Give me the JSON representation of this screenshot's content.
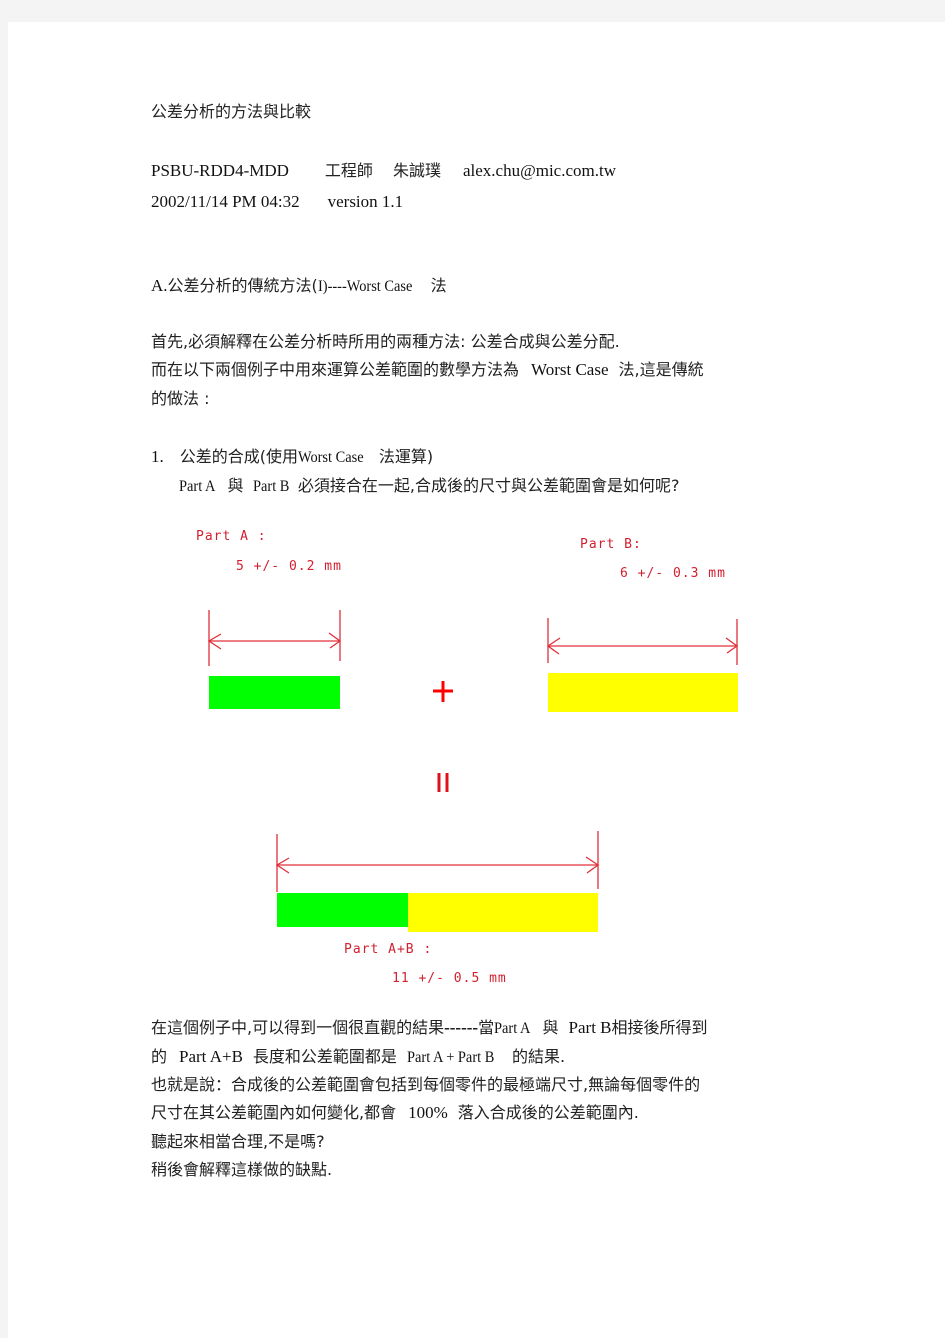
{
  "document": {
    "title": "公差分析的方法與比較",
    "author_line": {
      "department": "PSBU-RDD4-MDD",
      "role": "工程師",
      "name": "朱誠璞",
      "email": "alex.chu@mic.com.tw"
    },
    "date_line": {
      "datetime": "2002/11/14 PM 04:32",
      "version": "version 1.1"
    },
    "section_a": {
      "prefix": "A.",
      "heading_cjk": "公差分析的傳統方法(",
      "heading_roman": " I)----Worst  Case",
      "heading_suffix": "法"
    },
    "intro": {
      "line1": "首先,必須解釋在公差分析時所用的兩種方法:  公差合成與公差分配.",
      "line2_a": "而在以下兩個例子中用來運算公差範圍的數學方法為",
      "line2_b": "Worst Case",
      "line2_c": "法,這是傳統",
      "line3": "的做法  :"
    },
    "item1": {
      "number": "1.",
      "title_a": "公差的合成(使用",
      "title_b": "Worst  Case",
      "title_c": "法運算)",
      "q_part_a": "Part  A",
      "q_and": "與",
      "q_part_b": "Part B",
      "q_rest": "必須接合在一起,合成後的尺寸與公差範圍會是如何呢?"
    },
    "diagram": {
      "part_a": {
        "label": "Part A :",
        "nominal_mm": 5,
        "tolerance_mm": 0.2,
        "spec": "5 +/- 0.2 mm",
        "color": "#00ff00"
      },
      "part_b": {
        "label": "Part B:",
        "nominal_mm": 6,
        "tolerance_mm": 0.3,
        "spec": "6 +/- 0.3 mm",
        "color": "#ffff00"
      },
      "plus_symbol": "+",
      "equals_symbol": "=",
      "result": {
        "label": "Part A+B :",
        "nominal_mm": 11,
        "tolerance_mm": 0.5,
        "spec": "11 +/- 0.5 mm"
      },
      "dimension_color": "#e0303a",
      "label_color": "#d2202f"
    },
    "conclusion": {
      "l1_a": "在這個例子中,可以得到一個很直觀的結果",
      "l1_dash": "------",
      "l1_b": "當",
      "l1_pa": "Part  A",
      "l1_and": "與",
      "l1_pb": "Part B",
      "l1_c": "相接後所得到",
      "l2_a": "的",
      "l2_pab": "Part A+B",
      "l2_b": "長度和公差範圍都是",
      "l2_sum": "Part  A + Part  B",
      "l2_c": "的結果.",
      "l3": "也就是說：合成後的公差範圍會包括到每個零件的最極端尺寸,無論每個零件的",
      "l4_a": "尺寸在其公差範圍內如何變化,都會",
      "l4_pct": "100%",
      "l4_b": "落入合成後的公差範圍內.",
      "l5": "聽起來相當合理,不是嗎?",
      "l6": "稍後會解釋這樣做的缺點."
    }
  }
}
